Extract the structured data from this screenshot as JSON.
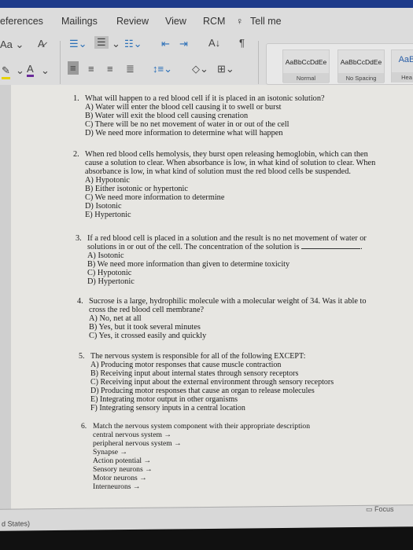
{
  "ribbon": {
    "tabs": [
      "eferences",
      "Mailings",
      "Review",
      "View",
      "RCM",
      "Tell me"
    ],
    "styles": [
      {
        "sample": "AaBbCcDdEe",
        "name": "Normal"
      },
      {
        "sample": "AaBbCcDdEe",
        "name": "No Spacing"
      },
      {
        "sample": "AaB",
        "name": "Hea"
      }
    ],
    "font_size_label": "Aa",
    "font_color_label": "A",
    "accent_color": "#1d3a8a"
  },
  "questions": [
    {
      "num": "1.",
      "text": "What will happen to a red blood cell if it is placed in an isotonic solution?",
      "options": [
        "A) Water will enter the blood cell causing it to swell or burst",
        "B) Water will exit the blood cell causing crenation",
        "C) There will be no net movement of water in or out of the cell",
        "D) We need more information to determine what will happen"
      ]
    },
    {
      "num": "2.",
      "text": "When red blood cells hemolysis, they burst open releasing hemoglobin, which can then cause a solution to clear. When absorbance is low, in what kind of solution to clear. When absorbance is low, in what kind of solution must the red blood cells be suspended.",
      "options": [
        "A) Hypotonic",
        "B) Either isotonic or hypertonic",
        "C) We need more information to determine",
        "D) Isotonic",
        "E) Hypertonic"
      ]
    },
    {
      "num": "3.",
      "text": "If a red blood cell is placed in a solution and the result is no net movement of water or solutions in or out of the cell. The concentration of the solution is",
      "options": [
        "A) Isotonic",
        "B) We need more information than given to determine toxicity",
        "C) Hypotonic",
        "D) Hypertonic"
      ]
    },
    {
      "num": "4.",
      "text": "Sucrose is a large, hydrophilic molecule with a molecular weight of 34. Was it able to cross the red blood cell membrane?",
      "options": [
        "A) No, net at all",
        "B) Yes, but it took several minutes",
        "C) Yes, it crossed easily and quickly"
      ]
    },
    {
      "num": "5.",
      "text": "The nervous system is responsible for all of the following EXCEPT:",
      "options": [
        "A) Producing motor responses that cause muscle contraction",
        "B) Receiving input about internal states through sensory receptors",
        "C) Receiving input about the external environment through sensory receptors",
        "D) Producing motor responses that cause an organ to release molecules",
        "E) Integrating motor output in other organisms",
        "F) Integrating sensory inputs in a central location"
      ]
    },
    {
      "num": "6.",
      "text": "Match the nervous system component with their appropriate description",
      "options": [
        "central nervous system →",
        "peripheral nervous system →",
        "Synapse →",
        "Action potential →",
        "Sensory neurons →",
        "Motor neurons →",
        "Interneurons →"
      ]
    }
  ],
  "status": {
    "language": "d States)",
    "focus": "Focus"
  }
}
